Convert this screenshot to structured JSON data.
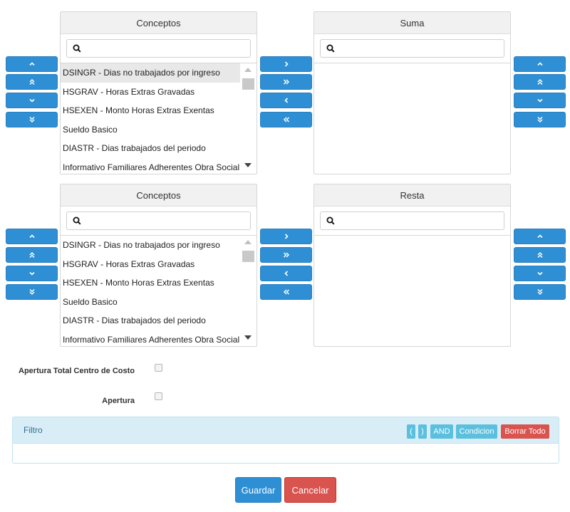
{
  "panels": {
    "conceptos_top": {
      "title": "Conceptos",
      "search_placeholder": ""
    },
    "suma": {
      "title": "Suma",
      "search_placeholder": ""
    },
    "conceptos_bottom": {
      "title": "Conceptos",
      "search_placeholder": ""
    },
    "resta": {
      "title": "Resta",
      "search_placeholder": ""
    }
  },
  "conceptos_items": [
    "DSINGR - Dias no trabajados por ingreso",
    "HSGRAV - Horas Extras Gravadas",
    "HSEXEN - Monto Horas Extras Exentas",
    "Sueldo Basico",
    "DIASTR - Dias trabajados del periodo",
    "Informativo Familiares Adherentes Obra Social"
  ],
  "options": {
    "apertura_total_label": "Apertura Total Centro de Costo",
    "apertura_label": "Apertura"
  },
  "filtro": {
    "title": "Filtro",
    "open_paren": "(",
    "close_paren": ")",
    "and": "AND",
    "condicion": "Condicion",
    "borrar_todo": "Borrar Todo"
  },
  "actions": {
    "guardar": "Guardar",
    "cancelar": "Cancelar"
  },
  "colors": {
    "primary": "#2e8fd4",
    "info": "#5bc0de",
    "danger": "#d9534f",
    "panel_info_bg": "#d9edf7"
  },
  "icons": [
    "search-icon",
    "chevron-up-icon",
    "double-chevron-up-icon",
    "chevron-down-icon",
    "double-chevron-down-icon",
    "chevron-right-icon",
    "double-chevron-right-icon",
    "chevron-left-icon",
    "double-chevron-left-icon"
  ]
}
